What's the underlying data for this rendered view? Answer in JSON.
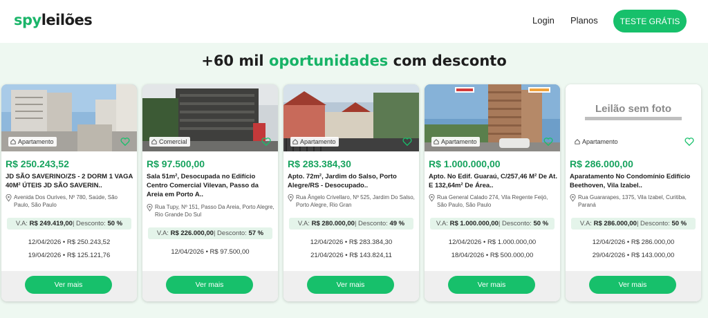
{
  "header": {
    "logo_part1": "spy",
    "logo_part2": "leilões",
    "login": "Login",
    "plans": "Planos",
    "cta": "TESTE GRÁTIS"
  },
  "headline": {
    "prefix": "+60 mil ",
    "highlight": "oportunidades",
    "suffix": " com desconto"
  },
  "cards": [
    {
      "type": "Apartamento",
      "price": "R$ 250.243,52",
      "title": "JD SÃO SAVERINO/ZS - 2 DORM 1 VAGA 40M² ÚTEIS JD SÃO SAVERIN..",
      "address": "Avenida Dos Ourives, Nº 780, Saúde, São Paulo, São Paulo",
      "va_label": "V.A: ",
      "va_value": "R$ 249.419,00",
      "disc_label": " | Desconto: ",
      "disc_value": "50 %",
      "dates": [
        "12/04/2026 • R$ 250.243,52",
        "19/04/2026 • R$ 125.121,76"
      ],
      "button": "Ver mais"
    },
    {
      "type": "Comercial",
      "price": "R$ 97.500,00",
      "title": "Sala 51m², Desocupada no Edifício Centro Comercial Vilevan, Passo da Areia em Porto A..",
      "address": "Rua Tupy, Nº 151, Passo Da Areia, Porto Alegre, Rio Grande Do Sul",
      "va_label": "V.A: ",
      "va_value": "R$ 226.000,00",
      "disc_label": " | Desconto: ",
      "disc_value": "57 %",
      "dates": [
        "12/04/2026 • R$ 97.500,00"
      ],
      "button": "Ver mais"
    },
    {
      "type": "Apartamento",
      "price": "R$ 283.384,30",
      "title": "Apto. 72m², Jardim do Salso, Porto Alegre/RS - Desocupado..",
      "address": "Rua Ângelo Crivellaro, Nº 525, Jardim Do Salso, Porto Alegre, Rio Gran",
      "va_label": "V.A: ",
      "va_value": "R$ 280.000,00",
      "disc_label": " | Desconto: ",
      "disc_value": "49 %",
      "dates": [
        "12/04/2026 • R$ 283.384,30",
        "21/04/2026 • R$ 143.824,11"
      ],
      "button": "Ver mais"
    },
    {
      "type": "Apartamento",
      "price": "R$ 1.000.000,00",
      "title": "Apto. No Edif. Guaraú, C/257,46 M² De At. E 132,64m² De Área..",
      "address": "Rua General Calado 274, Vila Regente Feijó, São Paulo, São Paulo",
      "va_label": "V.A: ",
      "va_value": "R$ 1.000.000,00",
      "disc_label": " | Desconto: ",
      "disc_value": "50 %",
      "dates": [
        "12/04/2026 • R$ 1.000.000,00",
        "18/04/2026 • R$ 500.000,00"
      ],
      "button": "Ver mais"
    },
    {
      "type": "Apartamento",
      "no_photo": "Leilão sem foto",
      "price": "R$ 286.000,00",
      "title": "Aparatamento No Condomínio Edifício Beethoven, Vila Izabel..",
      "address": "Rua Guararapes, 1375, Vila Izabel, Curitiba, Paraná",
      "va_label": "V.A: ",
      "va_value": "R$ 286.000,00",
      "disc_label": " | Desconto: ",
      "disc_value": "50 %",
      "dates": [
        "12/04/2026 • R$ 286.000,00",
        "29/04/2026 • R$ 143.000,00"
      ],
      "button": "Ver mais"
    }
  ],
  "colors": {
    "brand_green": "#17c06b",
    "price_green": "#17a35e",
    "band_bg": "#eef8f1",
    "discount_bg": "#e4f4ea"
  },
  "icons": [
    "home-icon",
    "heart-icon",
    "map-pin-icon"
  ]
}
